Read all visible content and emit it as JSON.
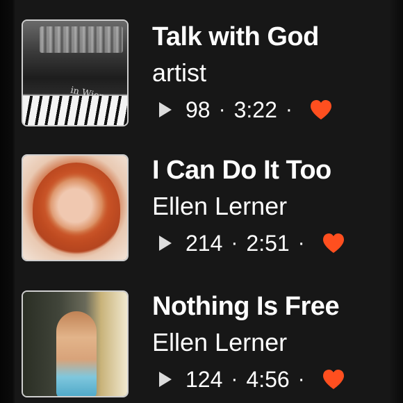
{
  "tracks": [
    {
      "title": "Talk with God",
      "artist": "artist",
      "plays": "98",
      "duration": "3:22",
      "cover": "piano-cover",
      "cover_text": "in Wien."
    },
    {
      "title": "I Can Do It Too",
      "artist": "Ellen Lerner",
      "plays": "214",
      "duration": "2:51",
      "cover": "portrait-redhead"
    },
    {
      "title": "Nothing Is Free",
      "artist": "Ellen Lerner",
      "plays": "124",
      "duration": "4:56",
      "cover": "portrait-blonde"
    }
  ],
  "ui": {
    "separator": "·",
    "accent_color": "#ff4f1f",
    "icon_play": "play-icon",
    "icon_like": "heart-icon"
  }
}
